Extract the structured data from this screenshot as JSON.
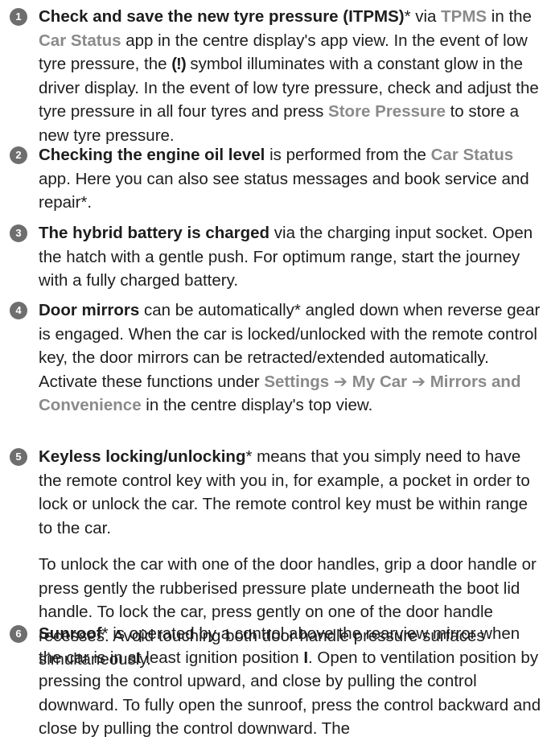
{
  "items": [
    {
      "number": "1",
      "t1": "Check and save the new tyre pressure (ITPMS)",
      "t2": "* via ",
      "t3": "TPMS",
      "t4": " in the ",
      "t5": "Car Status",
      "t6": " app in the centre display's app view. In the event of low tyre pressure, the ",
      "t7": "(!)",
      "t8": " symbol illuminates with a constant glow in the driver display. In the event of low tyre pressure, check and adjust the tyre pressure in all four tyres and press ",
      "t9": "Store Pressure",
      "t10": " to store a new tyre pressure."
    },
    {
      "number": "2",
      "t1": "Checking the engine oil level",
      "t2": " is performed from the ",
      "t3": "Car Status",
      "t4": " app. Here you can also see status messages and book service and repair*."
    },
    {
      "number": "3",
      "t1": "The hybrid battery is charged",
      "t2": " via the charging input socket. Open the hatch with a gentle push. For optimum range, start the journey with a fully charged battery."
    },
    {
      "number": "4",
      "t1": "Door mirrors",
      "t2": " can be automatically* angled down when reverse gear is engaged. When the car is locked/unlocked with the remote control key, the door mirrors can be retracted/extended automatically. Activate these functions under ",
      "t3": "Settings ➔ My Car ➔ Mirrors and Convenience",
      "t4": " in the centre display's top view."
    },
    {
      "number": "5",
      "t1": "Keyless locking/unlocking",
      "t2": "* means that you simply need to have the remote control key with you in, for example, a pocket in order to lock or unlock the car. The remote control key must be within range to the car.",
      "p2": "To unlock the car with one of the door handles, grip a door handle or press gently the rubberised pressure plate underneath the boot lid handle. To lock the car, press gently on one of the door handle recesses. Avoid touching both door handle pressure surfaces simultaneously."
    },
    {
      "number": "6",
      "t1": "Sunroof",
      "t2": "* is operated by a control above the rearview mirror when the car is in at least ignition position ",
      "t3": "I",
      "t4": ". Open to ventilation position by pressing the control upward, and close by pulling the control downward. To fully open the sunroof, press the control backward and close by pulling the control downward. The"
    }
  ]
}
